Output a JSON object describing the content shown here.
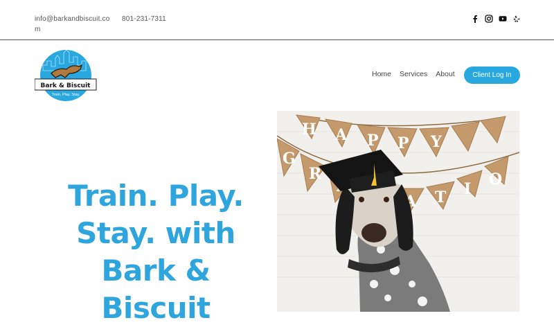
{
  "header": {
    "email": "info@barkandbiscuit.com",
    "phone": "801-231-7311",
    "social_icons": [
      "facebook-icon",
      "instagram-icon",
      "youtube-icon",
      "yelp-icon"
    ]
  },
  "logo": {
    "name": "Bark & Biscuit",
    "tagline": "Train. Play. Stay."
  },
  "nav": {
    "items": [
      "Home",
      "Services",
      "About"
    ],
    "client_login": "Client Log In"
  },
  "hero": {
    "title": "Train. Play. Stay. with Bark & Biscuit",
    "banner_letters": "HAPPY GRADUATION"
  },
  "colors": {
    "accent": "#29a8e0",
    "title": "#2ea6dd",
    "divider": "#555555"
  }
}
